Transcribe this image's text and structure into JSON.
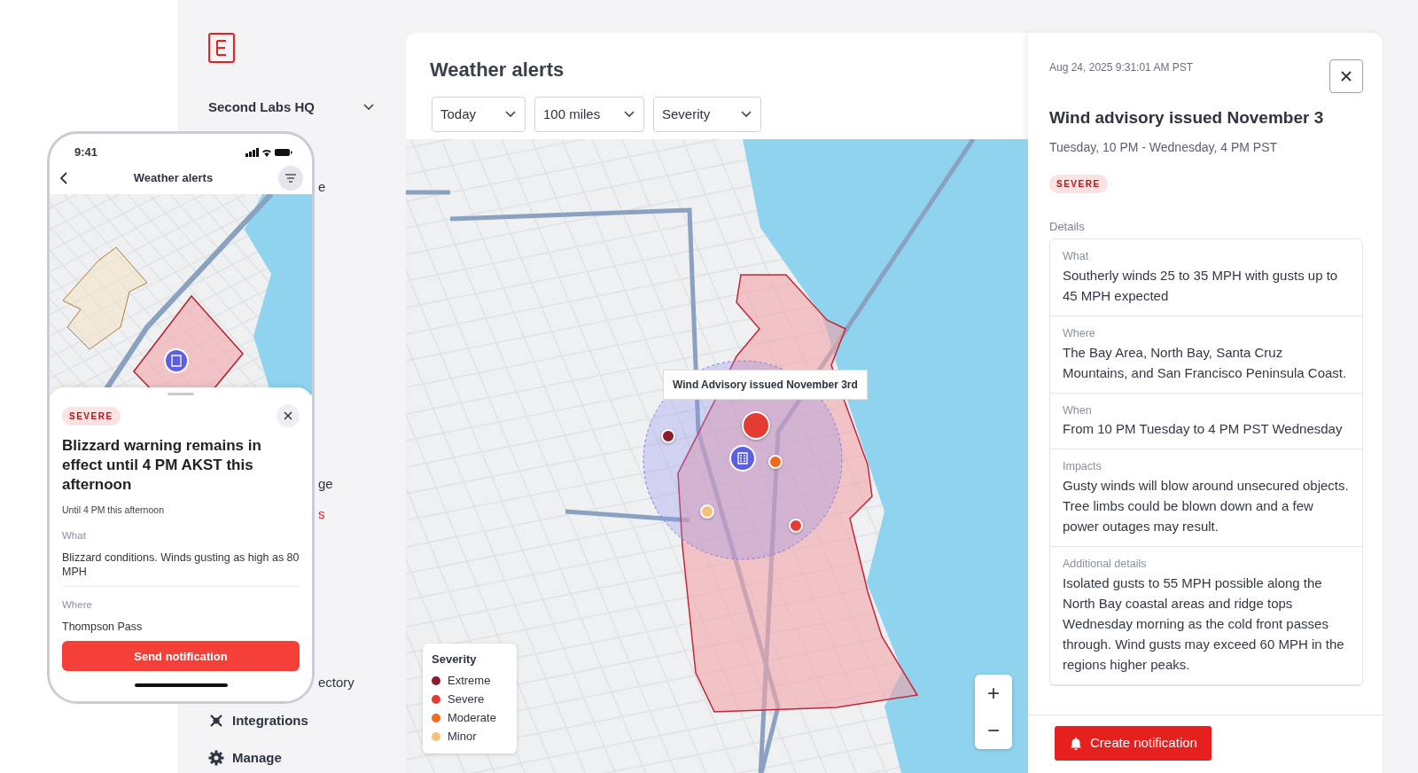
{
  "sidebar": {
    "workspace": "Second Labs HQ",
    "items": [
      {
        "label": "e",
        "kind": "clipped",
        "selected": false
      },
      {
        "label": "ge",
        "kind": "clipped",
        "selected": false
      },
      {
        "label": "s",
        "kind": "clipped",
        "selected": true
      },
      {
        "label": "ectory",
        "kind": "clipped",
        "selected": false
      },
      {
        "label": "Integrations",
        "kind": "integrations",
        "selected": false
      },
      {
        "label": "Manage",
        "kind": "manage",
        "selected": false
      }
    ]
  },
  "main": {
    "title": "Weather alerts",
    "filters": [
      "Today",
      "100 miles",
      "Severity"
    ],
    "map": {
      "tooltip": "Wind Advisory issued November 3rd",
      "markers": [
        {
          "kind": "point",
          "color": "#8e1b2c"
        },
        {
          "kind": "cluster",
          "color": "#e53b35"
        },
        {
          "kind": "point",
          "color": "#f26b1d"
        },
        {
          "kind": "point",
          "color": "#f7c07a"
        },
        {
          "kind": "point",
          "color": "#e53b35"
        }
      ],
      "legend": {
        "title": "Severity",
        "items": [
          {
            "label": "Extreme",
            "color": "#8e1b2c"
          },
          {
            "label": "Severe",
            "color": "#e53b35"
          },
          {
            "label": "Moderate",
            "color": "#f26b1d"
          },
          {
            "label": "Minor",
            "color": "#f7c07a"
          }
        ]
      },
      "zoom": [
        "+",
        "−"
      ]
    }
  },
  "detail": {
    "timestamp": "Aug 24, 2025  9:31:01 AM PST",
    "title": "Wind advisory issued November 3",
    "subtitle": "Tuesday, 10 PM - Wednesday, 4 PM PST",
    "badge": "SEVERE",
    "section": "Details",
    "fields": [
      {
        "label": "What",
        "text": "Southerly winds 25 to 35 MPH with gusts up to 45 MPH expected"
      },
      {
        "label": "Where",
        "text": "The Bay Area, North Bay, Santa Cruz Mountains, and San Francisco Peninsula Coast."
      },
      {
        "label": "When",
        "text": "From 10 PM Tuesday to 4 PM PST Wednesday"
      },
      {
        "label": "Impacts",
        "text": "Gusty winds will blow around unsecured objects.  Tree limbs could be blown down and a few power outages may result."
      },
      {
        "label": "Additional details",
        "text": "Isolated gusts to 55 MPH possible along the North Bay coastal areas and ridge tops Wednesday morning as the cold front passes through.  Wind gusts may exceed 60 MPH in the regions higher peaks."
      }
    ],
    "button": "Create notification"
  },
  "phone": {
    "time": "9:41",
    "title": "Weather alerts",
    "badge": "SEVERE",
    "alert_title": "Blizzard warning remains in effect until 4 PM AKST this afternoon",
    "until": "Until 4 PM this afternoon",
    "fields": [
      {
        "label": "What",
        "text": "Blizzard conditions. Winds gusting as high as 80 MPH"
      },
      {
        "label": "Where",
        "text": "Thompson Pass"
      }
    ],
    "button": "Send notification"
  }
}
